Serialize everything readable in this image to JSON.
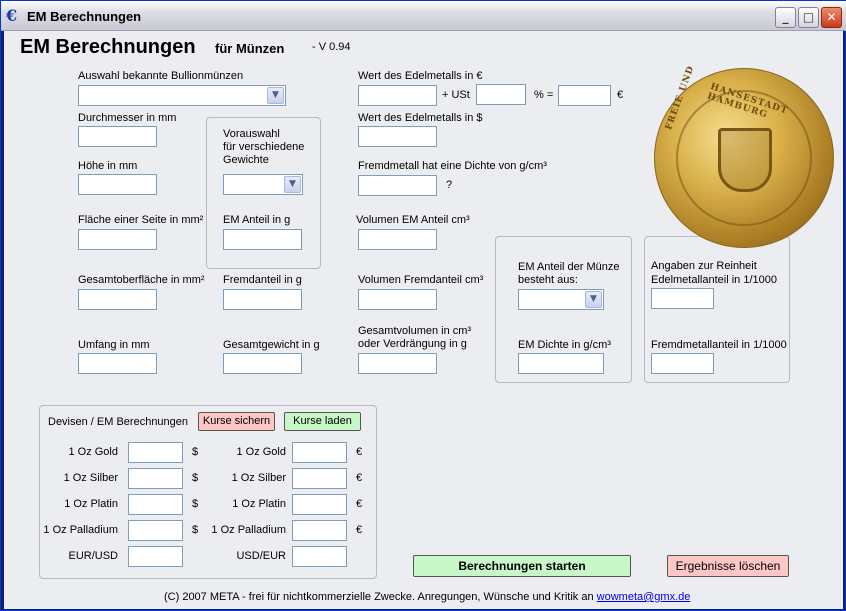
{
  "window": {
    "title": "EM Berechnungen"
  },
  "header": {
    "title": "EM Berechnungen",
    "subtitle": "für Münzen",
    "version": "- V 0.94"
  },
  "labels": {
    "auswahl": "Auswahl bekannte Bullionmünzen",
    "durchmesser": "Durchmesser in mm",
    "hoehe": "Höhe in mm",
    "flaeche": "Fläche einer Seite in mm²",
    "gesamtoberflaeche": "Gesamtoberfläche in mm²",
    "umfang": "Umfang in mm",
    "vorauswahl": "Vorauswahl",
    "vorauswahl2": "für verschiedene",
    "vorauswahl3": "Gewichte",
    "em_anteil_g": "EM Anteil in g",
    "fremdanteil_g": "Fremdanteil in g",
    "gesamtgewicht": "Gesamtgewicht in g",
    "wert_eur": "Wert des Edelmetalls in €",
    "ust": "+ USt",
    "pct_eq": "% =",
    "euro": "€",
    "wert_usd": "Wert des Edelmetalls in $",
    "fremdmetall_dichte": "Fremdmetall hat eine Dichte von g/cm³",
    "question": "?",
    "vol_em": "Volumen EM Anteil cm³",
    "vol_fremd": "Volumen Fremdanteil cm³",
    "gesamtvolumen1": "Gesamtvolumen in cm³",
    "gesamtvolumen2": "oder Verdrängung in g",
    "em_anteil_muenze1": "EM Anteil der Münze",
    "em_anteil_muenze2": "besteht aus:",
    "em_dichte": "EM Dichte in g/cm³",
    "reinheit1": "Angaben zur Reinheit",
    "reinheit2": "Edelmetallanteil in 1/1000",
    "fremdmetallanteil": "Fremdmetallanteil in 1/1000"
  },
  "devisen": {
    "title": "Devisen / EM Berechnungen",
    "save_label": "Kurse sichern",
    "load_label": "Kurse laden",
    "rows": [
      {
        "left": "1 Oz Gold",
        "cur_left": "$",
        "right": "1 Oz Gold",
        "cur_right": "€"
      },
      {
        "left": "1 Oz Silber",
        "cur_left": "$",
        "right": "1 Oz Silber",
        "cur_right": "€"
      },
      {
        "left": "1 Oz Platin",
        "cur_left": "$",
        "right": "1 Oz Platin",
        "cur_right": "€"
      },
      {
        "left": "1 Oz Palladium",
        "cur_left": "$",
        "right": "1 Oz Palladium",
        "cur_right": "€"
      },
      {
        "left": "EUR/USD",
        "cur_left": "",
        "right": "USD/EUR",
        "cur_right": ""
      }
    ]
  },
  "actions": {
    "start_label": "Berechnungen starten",
    "clear_label": "Ergebnisse löschen"
  },
  "footer": {
    "text": "(C) 2007 META - frei für nichtkommerzielle Zwecke.   Anregungen, Wünsche und Kritik an",
    "email": "wowmeta@gmx.de"
  },
  "coin": {
    "text_left": "FREIE UND",
    "text_right": "HANSESTADT HAMBURG"
  },
  "colors": {
    "button_red": "#ffc6c6",
    "button_green": "#c8f7c8",
    "window_bg": "#ecedf1"
  },
  "icons": {
    "app": "euro-icon",
    "minimize": "minimize-icon",
    "maximize": "maximize-icon",
    "close": "close-icon",
    "dropdown": "chevron-down-icon"
  }
}
